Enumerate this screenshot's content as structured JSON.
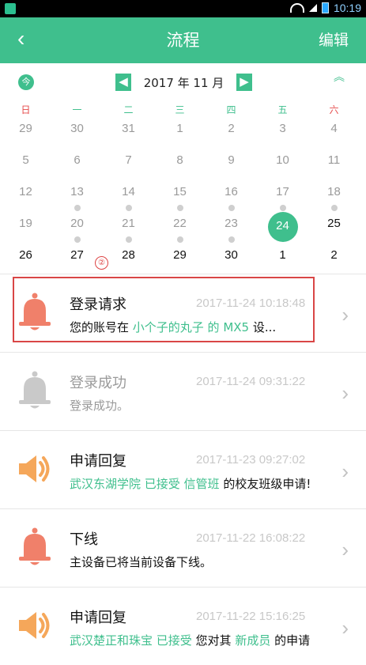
{
  "status_bar": {
    "time": "10:19"
  },
  "header": {
    "back_icon": "‹",
    "title": "流程",
    "edit_label": "编辑"
  },
  "calendar": {
    "today_label": "今",
    "prev_icon": "◀",
    "next_icon": "▶",
    "month_label": "2017 年 11 月",
    "collapse_icon": "︽",
    "weekdays": [
      "日",
      "一",
      "二",
      "三",
      "四",
      "五",
      "六"
    ],
    "weeks": [
      [
        {
          "d": "29",
          "cur": false,
          "dot": false
        },
        {
          "d": "30",
          "cur": false,
          "dot": false
        },
        {
          "d": "31",
          "cur": false,
          "dot": false
        },
        {
          "d": "1",
          "cur": false,
          "dot": false
        },
        {
          "d": "2",
          "cur": false,
          "dot": false
        },
        {
          "d": "3",
          "cur": false,
          "dot": false
        },
        {
          "d": "4",
          "cur": false,
          "dot": false
        }
      ],
      [
        {
          "d": "5",
          "cur": false,
          "dot": false
        },
        {
          "d": "6",
          "cur": false,
          "dot": false
        },
        {
          "d": "7",
          "cur": false,
          "dot": false
        },
        {
          "d": "8",
          "cur": false,
          "dot": false
        },
        {
          "d": "9",
          "cur": false,
          "dot": false
        },
        {
          "d": "10",
          "cur": false,
          "dot": false
        },
        {
          "d": "11",
          "cur": false,
          "dot": false
        }
      ],
      [
        {
          "d": "12",
          "cur": false,
          "dot": false
        },
        {
          "d": "13",
          "cur": false,
          "dot": true
        },
        {
          "d": "14",
          "cur": false,
          "dot": true
        },
        {
          "d": "15",
          "cur": false,
          "dot": true
        },
        {
          "d": "16",
          "cur": false,
          "dot": true
        },
        {
          "d": "17",
          "cur": false,
          "dot": true
        },
        {
          "d": "18",
          "cur": false,
          "dot": true
        }
      ],
      [
        {
          "d": "19",
          "cur": false,
          "dot": false
        },
        {
          "d": "20",
          "cur": false,
          "dot": true
        },
        {
          "d": "21",
          "cur": false,
          "dot": true
        },
        {
          "d": "22",
          "cur": false,
          "dot": true
        },
        {
          "d": "23",
          "cur": false,
          "dot": true
        },
        {
          "d": "24",
          "cur": true,
          "dot": false,
          "sel": true
        },
        {
          "d": "25",
          "cur": true,
          "dot": false
        }
      ],
      [
        {
          "d": "26",
          "cur": true,
          "dot": false
        },
        {
          "d": "27",
          "cur": true,
          "dot": false
        },
        {
          "d": "28",
          "cur": true,
          "dot": false
        },
        {
          "d": "29",
          "cur": true,
          "dot": false
        },
        {
          "d": "30",
          "cur": true,
          "dot": false
        },
        {
          "d": "1",
          "cur": true,
          "dot": false
        },
        {
          "d": "2",
          "cur": true,
          "dot": false
        }
      ]
    ],
    "annotation_marker": "②"
  },
  "feed": [
    {
      "icon": "bell-icon",
      "icon_color": "#f0806a",
      "title": "登录请求",
      "time": "2017-11-24 10:18:48",
      "body": [
        {
          "t": "您的账号在 "
        },
        {
          "t": "小个子的丸子 的 MX5",
          "hl": true
        },
        {
          "t": " 设..."
        }
      ],
      "dim": false,
      "boxed": true
    },
    {
      "icon": "bell-icon",
      "icon_color": "#c9c9c9",
      "title": "登录成功",
      "time": "2017-11-24 09:31:22",
      "body": [
        {
          "t": "登录成功。"
        }
      ],
      "dim": true,
      "boxed": false
    },
    {
      "icon": "speaker-icon",
      "icon_color": "#f5a75a",
      "title": "申请回复",
      "time": "2017-11-23 09:27:02",
      "body": [
        {
          "t": "武汉东湖学院 已接受 信管班",
          "hl": true
        },
        {
          "t": " 的校友班级申请!"
        }
      ],
      "dim": false,
      "boxed": false
    },
    {
      "icon": "bell-icon",
      "icon_color": "#f0806a",
      "title": "下线",
      "time": "2017-11-22 16:08:22",
      "body": [
        {
          "t": "主设备已将当前设备下线。"
        }
      ],
      "dim": false,
      "boxed": false
    },
    {
      "icon": "speaker-icon",
      "icon_color": "#f5a75a",
      "title": "申请回复",
      "time": "2017-11-22 15:16:25",
      "body": [
        {
          "t": "武汉楚正和珠宝 已接受",
          "hl": true
        },
        {
          "t": " 您对其 "
        },
        {
          "t": "新成员",
          "hl": true
        },
        {
          "t": " 的申请"
        }
      ],
      "dim": false,
      "boxed": false
    }
  ],
  "colors": {
    "accent": "#3fbf8d",
    "alert": "#d94646"
  }
}
